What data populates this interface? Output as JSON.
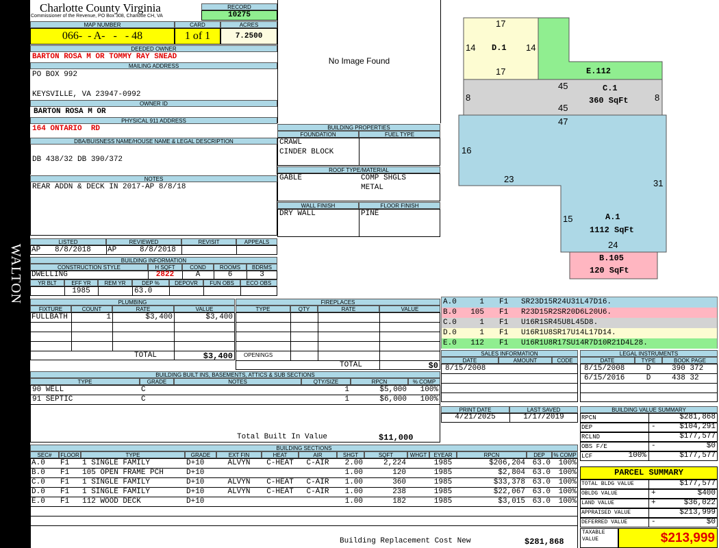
{
  "side_label": "WALTON",
  "county": {
    "title": "Charlotte County Virginia",
    "subtitle": "Commissioner of the Revenue, PO Box 308, Charlotte CH, VA"
  },
  "record": {
    "label": "RECORD",
    "value": "10275"
  },
  "map": {
    "label": "MAP NUMBER",
    "value": "066-  - A-   -   - 48"
  },
  "card": {
    "label": "CARD",
    "value": "1 of 1"
  },
  "acres": {
    "label": "ACRES",
    "value": "7.2500"
  },
  "deeded_owner": {
    "label": "DEEDED OWNER",
    "value": "BARTON ROSA M OR TOMMY RAY SNEAD"
  },
  "mailing": {
    "label": "MAILING ADDRESS",
    "line1": "PO BOX 992",
    "line2": "KEYSVILLE, VA 23947-0992"
  },
  "owner_id": {
    "label": "OWNER ID",
    "value": "BARTON ROSA M OR"
  },
  "physical": {
    "label": "PHYSICAL 911 ADDRESS",
    "value": "164 ONTARIO  RD"
  },
  "dba": {
    "label": "DBA/BUISNESS NAME/HOUSE NAME & LEGAL DESCRIPTION",
    "value": "DB 438/32 DB 390/372"
  },
  "notes": {
    "label": "NOTES",
    "value": "REAR ADDN & DECK IN 2017-AP 8/8/18"
  },
  "image": {
    "text": "No Image Found"
  },
  "building_props": {
    "label": "BUILDING PROPERTIES",
    "foundation_label": "FOUNDATION",
    "foundation": [
      "CRAWL",
      "CINDER BLOCK"
    ],
    "fueltype_label": "FUEL TYPE",
    "roof_label": "ROOF TYPE/MATERIAL",
    "roof_left": "GABLE",
    "roof_right": [
      "COMP SHGLS",
      "METAL"
    ],
    "wall_label": "WALL FINISH",
    "wall": "DRY WALL",
    "floor_label": "FLOOR FINISH",
    "floor": "PINE"
  },
  "review": {
    "listed_label": "LISTED",
    "reviewed_label": "REVIEWED",
    "revisit_label": "REVISIT",
    "appeals_label": "APPEALS",
    "listed_by": "AP",
    "listed_date": "8/8/2018",
    "reviewed_by": "AP",
    "reviewed_date": "8/8/2018"
  },
  "building_info": {
    "label": "BUILDING INFORMATION",
    "style_label": "CONSTRUCTION STYLE",
    "hsqft_label": "H SQFT",
    "cond_label": "COND",
    "rooms_label": "ROOMS",
    "bdrms_label": "BDRMS",
    "style": "DWELLING",
    "hsqft": "2822",
    "cond": "A",
    "rooms": "6",
    "bdrms": "3",
    "yrblt_label": "YR BLT",
    "effyr_label": "EFF YR",
    "remyr_label": "REM YR",
    "dep_label": "DEP %",
    "depovr_label": "DEPOVR",
    "funobs_label": "FUN OBS",
    "ecoobs_label": "ECO OBS",
    "effyr": "1985",
    "dep": "63.0"
  },
  "plumbing": {
    "label": "PLUMBING",
    "headers": [
      "FIXTURE",
      "COUNT",
      "RATE",
      "VALUE"
    ],
    "rows": [
      [
        "FULLBATH",
        "1",
        "$3,400",
        "$3,400"
      ]
    ],
    "total_label": "TOTAL",
    "total": "$3,400"
  },
  "fireplaces": {
    "label": "FIREPLACES",
    "headers": [
      "TYPE",
      "QTY",
      "RATE",
      "VALUE"
    ],
    "openings_label": "OPENINGS",
    "total_label": "TOTAL",
    "total": "$0"
  },
  "builtins": {
    "label": "BUILDING BUILT INS, BASEMENTS, ATTICS & SUB SECTIONS",
    "headers": [
      "TYPE",
      "GRADE",
      "NOTES",
      "QTY/SIZE",
      "RPCN",
      "% COMP"
    ],
    "rows": [
      [
        "90 WELL",
        "C",
        "",
        "1",
        "$5,000",
        "100%"
      ],
      [
        "91 SEPTIC",
        "C",
        "",
        "1",
        "$6,000",
        "100%"
      ]
    ],
    "total_label": "Total Built In Value",
    "total": "$11,000"
  },
  "sections": {
    "label": "BUILDING SECTIONS",
    "headers": [
      "SEC#",
      "FLOOR",
      "TYPE",
      "GRADE",
      "EXT FIN",
      "HEAT",
      "AIR",
      "SHGT",
      "SQFT",
      "WHGT",
      "EYEAR",
      "RPCN",
      "DEP",
      "% COMP"
    ],
    "rows": [
      [
        "A.0",
        "F1",
        "1 SINGLE FAMILY",
        "D+10",
        "ALVYN",
        "C-HEAT",
        "C-AIR",
        "2.00",
        "2,224",
        "",
        "1985",
        "$206,204",
        "63.0",
        "100%"
      ],
      [
        "B.0",
        "F1",
        "105 OPEN FRAME PCH",
        "D+10",
        "",
        "",
        "",
        "1.00",
        "120",
        "",
        "1985",
        "$2,804",
        "63.0",
        "100%"
      ],
      [
        "C.0",
        "F1",
        "1 SINGLE FAMILY",
        "D+10",
        "ALVYN",
        "C-HEAT",
        "C-AIR",
        "1.00",
        "360",
        "",
        "1985",
        "$33,378",
        "63.0",
        "100%"
      ],
      [
        "D.0",
        "F1",
        "1 SINGLE FAMILY",
        "D+10",
        "ALVYN",
        "C-HEAT",
        "C-AIR",
        "1.00",
        "238",
        "",
        "1985",
        "$22,067",
        "63.0",
        "100%"
      ],
      [
        "E.0",
        "F1",
        "112 WOOD DECK",
        "D+10",
        "",
        "",
        "",
        "1.00",
        "182",
        "",
        "1985",
        "$3,015",
        "63.0",
        "100%"
      ]
    ],
    "total_label": "Building Replacement Cost New",
    "total": "$281,868"
  },
  "sketch": {
    "D": {
      "label": "D.1",
      "top": "17",
      "bottom": "17",
      "left": "14",
      "right": "14"
    },
    "E": {
      "label": "E.112"
    },
    "C": {
      "label": "C.1",
      "area": "360 SqFt",
      "top": "45",
      "bottom": "45",
      "left": "8",
      "right": "8"
    },
    "A": {
      "label": "A.1",
      "area": "1112 SqFt",
      "top": "47",
      "left": "16",
      "mid": "23",
      "right": "31",
      "inner": "15",
      "bottom": "24"
    },
    "B": {
      "label": "B.105",
      "area": "120 SqFt"
    },
    "colors": {
      "D": "#fdfcd2",
      "E": "#90ee90",
      "C": "#d3d3d3",
      "A": "#add8e6",
      "B": "#ffb6c1"
    }
  },
  "codes": [
    {
      "sec": "A.0",
      "num": "1",
      "fl": "F1",
      "code": "SR23D15R24U31L47D16.",
      "color": "#add8e6"
    },
    {
      "sec": "B.0",
      "num": "105",
      "fl": "F1",
      "code": "R23D15R2SR20D6L20U6.",
      "color": "#ffb6c1"
    },
    {
      "sec": "C.0",
      "num": "1",
      "fl": "F1",
      "code": "U16R1SR45U8L45D8.",
      "color": "#d3d3d3"
    },
    {
      "sec": "D.0",
      "num": "1",
      "fl": "F1",
      "code": "U16R1U8SR17U14L17D14.",
      "color": "#fdfcd2"
    },
    {
      "sec": "E.0",
      "num": "112",
      "fl": "F1",
      "code": "U16R1U8R17SU14R7D10R21D4L28.",
      "color": "#90ee90"
    }
  ],
  "sales": {
    "label": "SALES INFORMATION",
    "headers": [
      "DATE",
      "AMOUNT",
      "CODE"
    ],
    "rows": [
      [
        "8/15/2008",
        "",
        ""
      ]
    ]
  },
  "legal": {
    "label": "LEGAL INSTRUMENTS",
    "headers": [
      "DATE",
      "TYPE",
      "BOOK PAGE"
    ],
    "rows": [
      [
        "8/15/2008",
        "D",
        "390 372"
      ],
      [
        "6/15/2016",
        "D",
        "438 32"
      ]
    ]
  },
  "print": {
    "print_label": "PRINT DATE",
    "print_date": "4/21/2025",
    "saved_label": "LAST SAVED",
    "saved_date": "1/17/2019"
  },
  "bvs": {
    "label": "BUILDING VALUE SUMMARY",
    "rows": [
      {
        "k": "RPCN",
        "mid": "",
        "sign": "",
        "v": "$281,868"
      },
      {
        "k": "DEP",
        "mid": "",
        "sign": "-",
        "v": "$104,291"
      },
      {
        "k": "RCLND",
        "mid": "",
        "sign": "",
        "v": "$177,577"
      },
      {
        "k": "OBS F/E",
        "mid": "",
        "sign": "-",
        "v": "$0"
      },
      {
        "k": "LCF",
        "mid": "100%",
        "sign": "",
        "v": "$177,577"
      }
    ]
  },
  "parcel": {
    "label": "PARCEL SUMMARY",
    "rows": [
      {
        "k": "TOTAL BLDG VALUE",
        "sign": "",
        "v": "$177,577"
      },
      {
        "k": "OBLDG VALUE",
        "sign": "+",
        "v": "$400"
      },
      {
        "k": "LAND VALUE",
        "sign": "+",
        "v": "$36,022"
      },
      {
        "k": "APPRAISED VALUE",
        "sign": "",
        "v": "$213,999"
      },
      {
        "k": "DEFERRED VALUE",
        "sign": "-",
        "v": "$0"
      }
    ],
    "taxable_label": "TAXABLE VALUE",
    "taxable": "$213,999"
  }
}
